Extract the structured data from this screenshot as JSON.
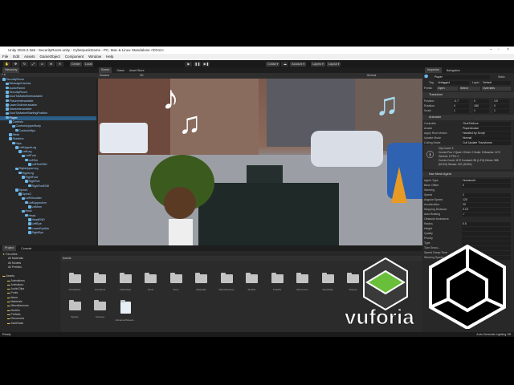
{
  "window": {
    "title": "Unity 2019.2.3a5 - SecurityRoom.unity - CyberpunkGame - PC, Mac & Linux Standalone <DX11>"
  },
  "menu": [
    "File",
    "Edit",
    "Assets",
    "GameObject",
    "Component",
    "Window",
    "Help"
  ],
  "toolbar": {
    "pivot": "Center",
    "space": "Local",
    "collab": "Collab ▾",
    "account": "Account ▾",
    "layers": "Layers ▾",
    "layout": "Layout ▾",
    "play": "▶",
    "pause": "❚❚",
    "step": "▶❚"
  },
  "hierarchy": {
    "title": "Hierarchy",
    "items": [
      {
        "l": "SecurityRoom",
        "d": 0
      },
      {
        "l": "MessageCanvas",
        "d": 1
      },
      {
        "l": "AudioParent",
        "d": 1
      },
      {
        "l": "SecurityRoom",
        "d": 1
      },
      {
        "l": "DoorToMarketInteractable",
        "d": 1
      },
      {
        "l": "PictureInteractable",
        "d": 1
      },
      {
        "l": "LaserGridInteractable",
        "d": 1
      },
      {
        "l": "StairsInteractable",
        "d": 1
      },
      {
        "l": "DoorToMarketStartingPosition",
        "d": 1
      },
      {
        "l": "Player",
        "d": 1,
        "sel": true
      },
      {
        "l": "Controls",
        "d": 2
      },
      {
        "l": "ControlsUpperBody",
        "d": 3
      },
      {
        "l": "ControlsHips",
        "d": 4
      },
      {
        "l": "Mesh",
        "d": 2
      },
      {
        "l": "Skeleton",
        "d": 2
      },
      {
        "l": "Hips",
        "d": 3
      },
      {
        "l": "LeftUpperLeg",
        "d": 4
      },
      {
        "l": "LeftLeg",
        "d": 5
      },
      {
        "l": "LeftFoot",
        "d": 6
      },
      {
        "l": "LeftToe",
        "d": 7
      },
      {
        "l": "LeftToeEND",
        "d": 8
      },
      {
        "l": "RightUpperLeg",
        "d": 4
      },
      {
        "l": "RightLeg",
        "d": 5
      },
      {
        "l": "RightFoot",
        "d": 6
      },
      {
        "l": "RightToe",
        "d": 7
      },
      {
        "l": "RightToeEND",
        "d": 8
      },
      {
        "l": "Spine1",
        "d": 4
      },
      {
        "l": "Spine2",
        "d": 5
      },
      {
        "l": "LeftShoulder",
        "d": 6
      },
      {
        "l": "LeftUpperArm",
        "d": 7
      },
      {
        "l": "LeftArm",
        "d": 8
      },
      {
        "l": "Neck",
        "d": 6
      },
      {
        "l": "Head",
        "d": 7
      },
      {
        "l": "HeadEND",
        "d": 8
      },
      {
        "l": "LeftEye",
        "d": 8
      },
      {
        "l": "LowerEyelids",
        "d": 8
      },
      {
        "l": "RightEye",
        "d": 8
      }
    ]
  },
  "scene": {
    "tabs": [
      "Scene",
      "Game",
      "Asset Store"
    ],
    "shading": "Shaded",
    "mode2d": "2D",
    "gizmos": "Gizmos"
  },
  "inspector": {
    "tabs": [
      "Inspector",
      "Navigation"
    ],
    "name": "Player",
    "static": "Static",
    "tag_label": "Tag",
    "tag": "Untagged",
    "layer_label": "Layer",
    "layer": "Default",
    "prefab_label": "Prefab",
    "open": "Open",
    "select": "Select",
    "overrides": "Overrides",
    "transform": {
      "title": "Transform",
      "rows": [
        {
          "l": "Position",
          "x": "-0.7",
          "y": "0",
          "z": "3.5"
        },
        {
          "l": "Rotation",
          "x": "0",
          "y": "180",
          "z": "0"
        },
        {
          "l": "Scale",
          "x": "1",
          "y": "1",
          "z": "1"
        }
      ]
    },
    "animator": {
      "title": "Animator",
      "rows": [
        {
          "l": "Controller",
          "v": "ClickToMove"
        },
        {
          "l": "Avatar",
          "v": "PlayerAvatar"
        },
        {
          "l": "Apply Root Motion",
          "v": "Handled by Script"
        },
        {
          "l": "Update Mode",
          "v": "Normal"
        },
        {
          "l": "Culling Mode",
          "v": "Cull Update Transforms"
        }
      ],
      "info": [
        "Clip Count: 9",
        "Curves Pos: 2 Quat: 0 Euler: 0 Scale: 0 Muscles: 1170",
        "Generic: 0 PPtr: 0",
        "Curves Count: 1170 Constant: 55 (1.2%) Dense: 588",
        "(50.3%) Stream: 547 (46.8%)"
      ]
    },
    "navmesh": {
      "title": "Nav Mesh Agent",
      "rows": [
        {
          "l": "Agent Type",
          "v": "Humanoid"
        },
        {
          "l": "Base Offset",
          "v": "0"
        },
        {
          "l": "Steering",
          "v": ""
        },
        {
          "l": "Speed",
          "v": "2"
        },
        {
          "l": "Angular Speed",
          "v": "120"
        },
        {
          "l": "Acceleration",
          "v": "20"
        },
        {
          "l": "Stopping Distance",
          "v": "0.15"
        },
        {
          "l": "Auto Braking",
          "v": "✓"
        },
        {
          "l": "Obstacle Avoidance",
          "v": ""
        },
        {
          "l": "Radius",
          "v": "0.5"
        },
        {
          "l": "Height",
          "v": ""
        },
        {
          "l": "Quality",
          "v": ""
        },
        {
          "l": "Priority",
          "v": ""
        }
      ]
    },
    "extra": [
      {
        "l": "Type",
        "v": ""
      },
      {
        "l": "Turn Smoo...",
        "v": ""
      },
      {
        "l": "Speed Damp Time",
        "v": ""
      },
      {
        "l": "Steering Speed",
        "v": "0.175"
      }
    ]
  },
  "project": {
    "tabs": [
      "Project",
      "Console"
    ],
    "favorites": {
      "title": "Favorites",
      "items": [
        "All Materials",
        "All Models",
        "All Prefabs"
      ]
    },
    "assets_title": "Assets",
    "tree": [
      "Animations",
      "Animators",
      "AudioClips",
      "Fonts",
      "Items",
      "Materials",
      "Miscellaneous",
      "Models",
      "Prefabs",
      "Resources",
      "SaveData"
    ],
    "breadcrumb": "Assets",
    "folders": [
      "Animations",
      "Animators",
      "AudioClips",
      "Fonts",
      "Items",
      "Materials",
      "Miscellaneous",
      "Models",
      "Prefabs",
      "Resources",
      "SaveData",
      "Scenes",
      "Scripts"
    ],
    "folders2": [
      "Sprites",
      "Textures",
      "AdvancedSaveE..."
    ]
  },
  "logos": {
    "vuforia": "vuforia",
    "tm": "TM"
  },
  "status": {
    "left": "Ready",
    "right": "Auto Generate Lighting Off"
  }
}
